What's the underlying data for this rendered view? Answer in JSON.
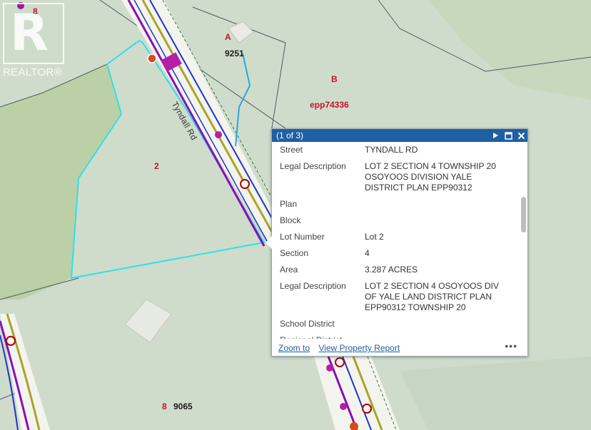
{
  "map": {
    "labels": {
      "lot_a": "A",
      "addr_9251": "9251",
      "lot_b": "B",
      "plan_epp74336": "epp74336",
      "lot_2": "2",
      "lot_8_top": "8",
      "lot_8_bottom": "8",
      "addr_9065": "9065"
    },
    "road_name": "Tyndall Rd",
    "colors": {
      "terrain": "#cfdccb",
      "field": "#b5cd9c",
      "parcel_line": "#4a5a66",
      "highlight": "#2fe0ea",
      "road_corridor": "#ffffff",
      "road_center": "#a9a42a",
      "route_purple": "#8a0fb5",
      "route_blue": "#1e36c8",
      "lot_label_red": "#c8102e"
    }
  },
  "logo": {
    "mark": "R",
    "text": "REALTOR®"
  },
  "popup": {
    "title": "(1 of 3)",
    "controls": [
      "next-icon",
      "maximize-icon",
      "close-icon"
    ],
    "fields": [
      {
        "key": "Street",
        "value": "TYNDALL RD"
      },
      {
        "key": "Legal Description",
        "value": "LOT 2 SECTION 4 TOWNSHIP 20 OSOYOOS DIVISION YALE DISTRICT PLAN EPP90312"
      },
      {
        "key": "Plan",
        "value": ""
      },
      {
        "key": "Block",
        "value": ""
      },
      {
        "key": "Lot Number",
        "value": "Lot 2"
      },
      {
        "key": "Section",
        "value": "4"
      },
      {
        "key": "Area",
        "value": "3.287 ACRES"
      },
      {
        "key": "Legal Description",
        "value": "LOT 2 SECTION 4 OSOYOOS DIV OF YALE LAND DISTRICT PLAN EPP90312 TOWNSHIP 20"
      },
      {
        "key": "School District",
        "value": ""
      },
      {
        "key": "Regional District",
        "value": ""
      }
    ],
    "links": {
      "zoom": "Zoom to",
      "report": "View Property Report"
    },
    "more_label": "•••"
  }
}
